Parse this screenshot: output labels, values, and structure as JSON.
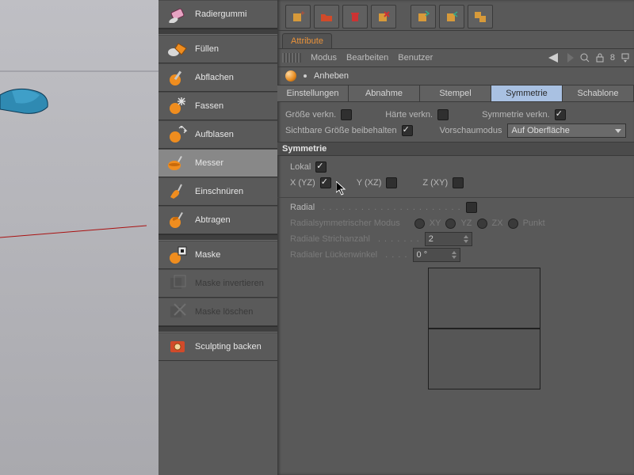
{
  "tools": [
    {
      "id": "radiergummi",
      "label": "Radiergummi"
    },
    {
      "id": "fuellen",
      "label": "Füllen"
    },
    {
      "id": "abflachen",
      "label": "Abflachen"
    },
    {
      "id": "fassen",
      "label": "Fassen"
    },
    {
      "id": "aufblasen",
      "label": "Aufblasen"
    },
    {
      "id": "messer",
      "label": "Messer"
    },
    {
      "id": "einschnueren",
      "label": "Einschnüren"
    },
    {
      "id": "abtragen",
      "label": "Abtragen"
    }
  ],
  "masktools": [
    {
      "id": "maske",
      "label": "Maske"
    },
    {
      "id": "maske-inv",
      "label": "Maske invertieren"
    },
    {
      "id": "maske-del",
      "label": "Maske löschen"
    }
  ],
  "bake": {
    "label": "Sculpting backen"
  },
  "attr_tab": "Attribute",
  "menu": {
    "modus": "Modus",
    "bearbeiten": "Bearbeiten",
    "benutzer": "Benutzer"
  },
  "tool_title": "Anheben",
  "subtabs": {
    "einstellungen": "Einstellungen",
    "abnahme": "Abnahme",
    "stempel": "Stempel",
    "symmetrie": "Symmetrie",
    "schablone": "Schablone"
  },
  "props": {
    "groesse": "Größe verkn.",
    "haerte": "Härte verkn.",
    "symverkn": "Symmetrie verkn.",
    "sichtbare": "Sichtbare Größe beibehalten",
    "vorschau": "Vorschaumodus",
    "vorschau_value": "Auf Oberfläche"
  },
  "section": "Symmetrie",
  "sym": {
    "lokal": "Lokal",
    "xyz_x": "X (YZ)",
    "xyz_y": "Y (XZ)",
    "xyz_z": "Z (XY)",
    "radial": "Radial",
    "radmode": "Radialsymmetrischer Modus",
    "rad_xy": "XY",
    "rad_yz": "YZ",
    "rad_zx": "ZX",
    "rad_punkt": "Punkt",
    "strichanzahl": "Radiale Strichanzahl",
    "strichanzahl_val": "2",
    "lueckenwinkel": "Radialer Lückenwinkel",
    "lueckenwinkel_val": "0 °"
  }
}
